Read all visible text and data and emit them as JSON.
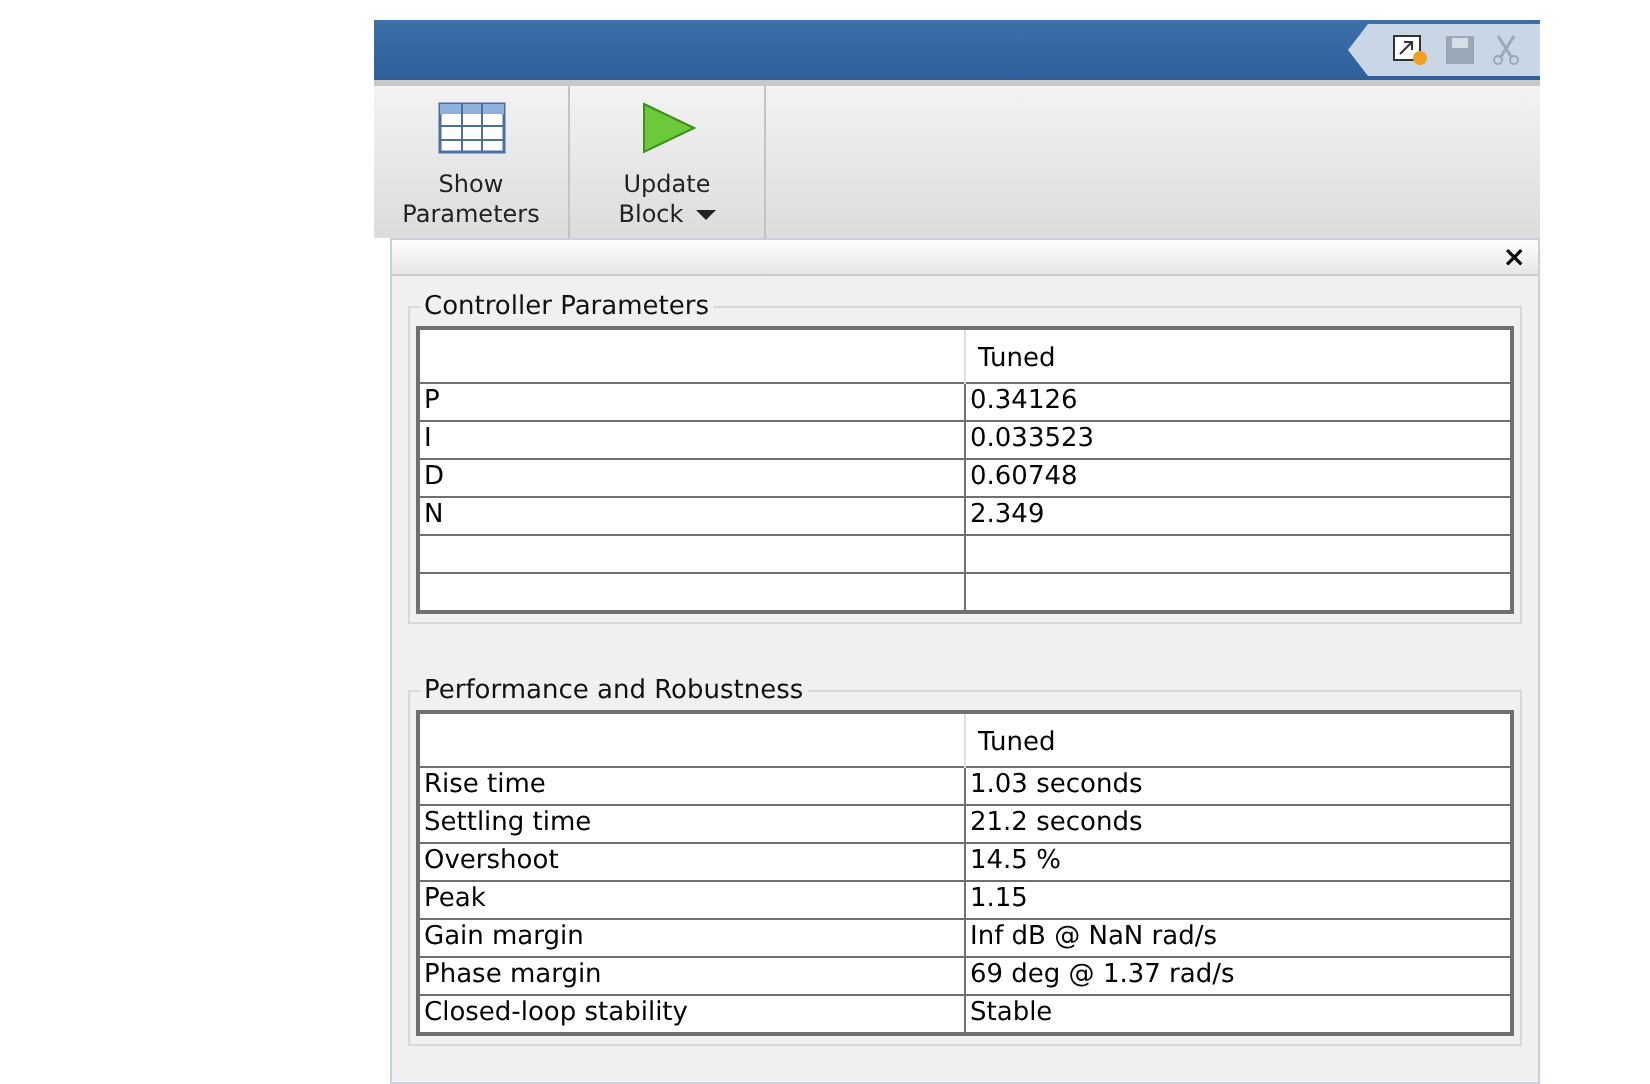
{
  "toolbar": {
    "buttons": [
      {
        "kind": "table",
        "line1": "Show",
        "line2": "Parameters",
        "caret": false
      },
      {
        "kind": "play",
        "line1": "Update",
        "line2": "Block",
        "caret": true
      }
    ]
  },
  "panel": {
    "close": "×"
  },
  "groups": [
    {
      "title": "Controller Parameters",
      "header": "Tuned",
      "rows": [
        [
          "P",
          "0.34126"
        ],
        [
          "I",
          "0.033523"
        ],
        [
          "D",
          "0.60748"
        ],
        [
          "N",
          "2.349"
        ],
        [
          "",
          ""
        ],
        [
          "",
          ""
        ]
      ]
    },
    {
      "title": "Performance and Robustness",
      "header": "Tuned",
      "rows": [
        [
          "Rise time",
          "1.03 seconds"
        ],
        [
          "Settling time",
          "21.2 seconds"
        ],
        [
          "Overshoot",
          "14.5 %"
        ],
        [
          "Peak",
          "1.15"
        ],
        [
          "Gain margin",
          "Inf dB @ NaN rad/s"
        ],
        [
          "Phase margin",
          "69 deg @ 1.37 rad/s"
        ],
        [
          "Closed-loop stability",
          "Stable"
        ]
      ]
    }
  ]
}
